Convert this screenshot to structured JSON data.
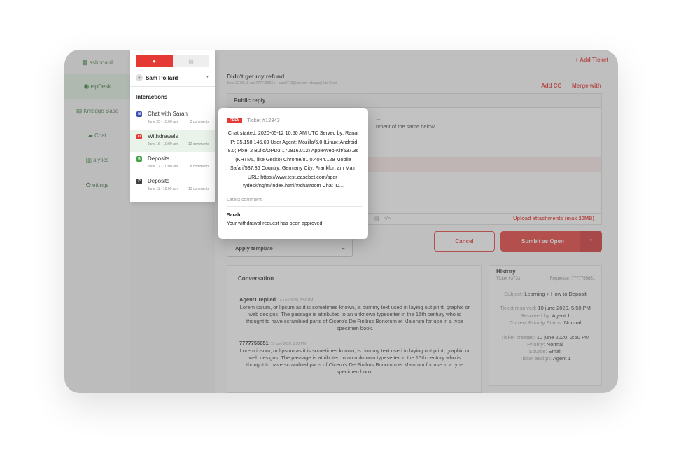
{
  "nav": {
    "items": [
      {
        "label": "ashboard",
        "icon": "dashboard-icon"
      },
      {
        "label": "elpDesk",
        "icon": "helpdesk-icon"
      },
      {
        "label": "Knledge Base",
        "icon": "knowledge-base-icon"
      },
      {
        "label": "Chat",
        "icon": "chat-icon"
      },
      {
        "label": "alytics",
        "icon": "analytics-icon"
      },
      {
        "label": "ettings",
        "icon": "settings-icon"
      }
    ]
  },
  "header": {
    "add_ticket": "+ Add Ticket",
    "ticket_title": "Didn't get my refund",
    "ticket_sub": "June 22 09:15 am 7777755651 · sam2773@yz.com (change) Via Chat",
    "add_cc": "Add CC",
    "merge": "Merge with"
  },
  "reply": {
    "label": "Public reply",
    "text_line1": "...",
    "text_line2": "nment of the same below.",
    "toolbar": "▤ ·   </>",
    "upload": "Upload attachments (max 20MB)"
  },
  "actions": {
    "template": "Apply template",
    "cancel": "Cancel",
    "submit": "Sumbit as Open"
  },
  "conversation": {
    "title": "Conversation",
    "messages": [
      {
        "who": "Agent1 replied",
        "when": "14 june 2020, 3:50 PM",
        "text": "Lorem ipsum, or lipsum as it is sometimes known, is dummy text used in laying out print, graphic or web designs. The passage is attributed to an unknown typesetter in the 15th century who is thought to have scrambled parts of Cicero's De Finibus Bonorum et Malorum for use in a type specimen book."
      },
      {
        "who": "7777755651",
        "when": "10 june 2020, 3:50 PM",
        "text": "Lorem ipsum, or lipsum as it is sometimes known, is dummy text used in laying out print, graphic or web designs. The passage is attributed to an unknown typesetter in the 15th century who is thought to have scrambled parts of Cicero's De Finibus Bonorum et Malorum for use in a type specimen book."
      }
    ]
  },
  "history": {
    "title": "History",
    "ticket": "Ticket #3733",
    "requester": "Requester: 7777755651",
    "subject_k": "Subject:",
    "subject_v": "Learning + How to Deposit",
    "resolved_k": "Ticket resolved:",
    "resolved_v": "10 june 2020, 5:50 PM",
    "resolvedby_k": "Resolved by:",
    "resolvedby_v": "Agent 1",
    "priority_status_k": "Current Priority Status:",
    "priority_status_v": "Normal",
    "created_k": "Ticket created:",
    "created_v": "10 june 2020, 2:50 PM",
    "priority_k": "Priority:",
    "priority_v": "Normal",
    "source_k": "Source:",
    "source_v": "Email",
    "assign_k": "Ticket assign:",
    "assign_v": "Agent 1"
  },
  "panel": {
    "user": "Sam Pollard",
    "title": "Interactions",
    "items": [
      {
        "badge": "N",
        "color": "#3f51b5",
        "name": "Chat with Sarah",
        "date": "June 20 · 10:00 am",
        "count": "3 comments"
      },
      {
        "badge": "O",
        "color": "#e53935",
        "name": "Withdrawals",
        "date": "June 16 · 10:00 am",
        "count": "12 comments"
      },
      {
        "badge": "R",
        "color": "#43a047",
        "name": "Deposits",
        "date": "June 12 · 10:00 am",
        "count": "8 comments"
      },
      {
        "badge": "P",
        "color": "#424242",
        "name": "Deposits",
        "date": "June 11 · 10:00 am",
        "count": "13 comments"
      }
    ]
  },
  "card": {
    "status": "OPEN",
    "ticket": "Ticket #12343",
    "body": "Chat started: 2020-05-12 10:50 AM UTC Served by: Ranat IP: 35.158.145.69 User Agent: Mozilla/5.0 (Linux; Android 8.0; Pixel 2 Build/OPD3.170816.012) AppleWeb-Kit/537.36 (KHTML, like Gecko) Chrome/81.0.4044.129 Mobile Safari/537.36 Country: Germany City: Frankfurt am Main URL: https://www.test.easebet.com/spor-tydesk/ng/m/index.html/#/chatroom Chat ID...",
    "latest_label": "Latest comment",
    "comment_author": "Sarah",
    "comment_text": "Your withdrawal request has been approved"
  }
}
